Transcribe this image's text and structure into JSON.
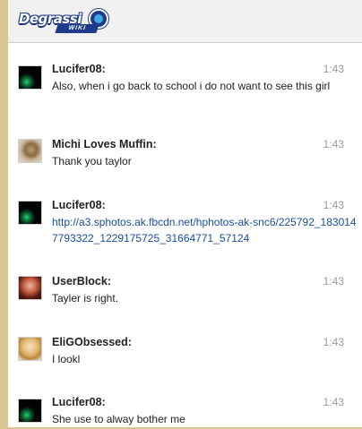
{
  "app": {
    "logo_text": "Degrassi",
    "logo_subtext": "WIKI"
  },
  "messages": [
    {
      "username": "Lucifer08:",
      "time": "1:43",
      "text": "Also, when i go back to school i do not want to see this girl",
      "avatar": "lucifer08-avatar"
    },
    {
      "username": "Michi Loves Muffin:",
      "time": "1:43",
      "text": "Thank you taylor",
      "avatar": "michi-avatar"
    },
    {
      "username": "Lucifer08:",
      "time": "1:43",
      "text": "http://a3.sphotos.ak.fbcdn.net/hphotos-ak-snc6/225792_1830147793322_1229175725_31664771_57124",
      "avatar": "lucifer08-avatar"
    },
    {
      "username": "UserBlock:",
      "time": "1:43",
      "text": "Tayler is right.",
      "avatar": "userblock-avatar"
    },
    {
      "username": "EliGObsessed:",
      "time": "1:43",
      "text": "I lookl",
      "avatar": "eligobsessed-avatar"
    },
    {
      "username": "Lucifer08:",
      "time": "1:43",
      "text": "She use to alway bother me",
      "avatar": "lucifer08-avatar"
    }
  ],
  "colors": {
    "frame": "#d8c58f",
    "link": "#1a4fa0",
    "timestamp": "#9a9a9a"
  }
}
